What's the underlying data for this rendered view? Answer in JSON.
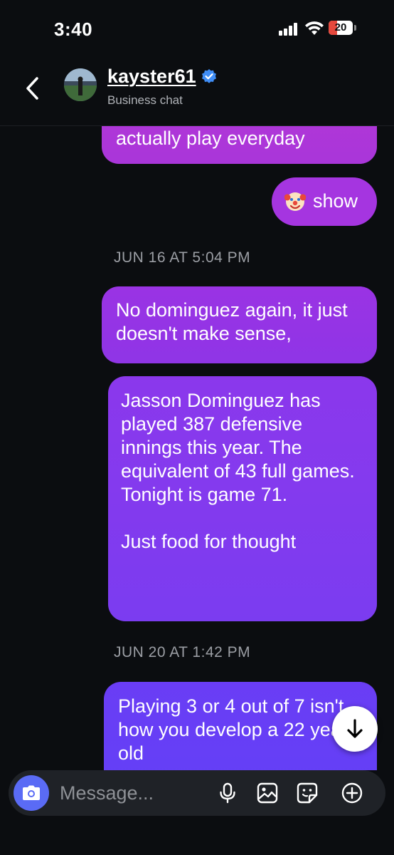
{
  "status_bar": {
    "time": "3:40",
    "battery_level": "20",
    "battery_color": "#e5483d"
  },
  "header": {
    "name": "kayster61",
    "subtitle": "Business chat",
    "icons": [
      "back-chevron-icon",
      "verified-badge-icon"
    ]
  },
  "messages": [
    {
      "text": "actually play everyday"
    },
    {
      "emoji": "clown-face-icon",
      "text": "show"
    }
  ],
  "timestamps": [
    "JUN 16 AT 5:04 PM",
    "JUN 20 AT 1:42 PM"
  ],
  "messages2": [
    {
      "text": "No dominguez again, it just doesn't make sense,"
    },
    {
      "text": "Jasson Dominguez has played 387 defensive innings this year. The equivalent of 43 full games. Tonight is game 71.\n\nJust food for thought"
    },
    {
      "text": "Playing 3 or 4 out of 7 isn't how you develop a 22 year old"
    }
  ],
  "composer": {
    "placeholder": "Message...",
    "icons": [
      "camera-icon",
      "microphone-icon",
      "gallery-icon",
      "sticker-icon",
      "add-icon"
    ]
  },
  "colors": {
    "accent": "#5a6bf5",
    "bubble_top": "#b137d8",
    "bubble_bottom": "#6340f6",
    "background": "#0b0d10"
  }
}
